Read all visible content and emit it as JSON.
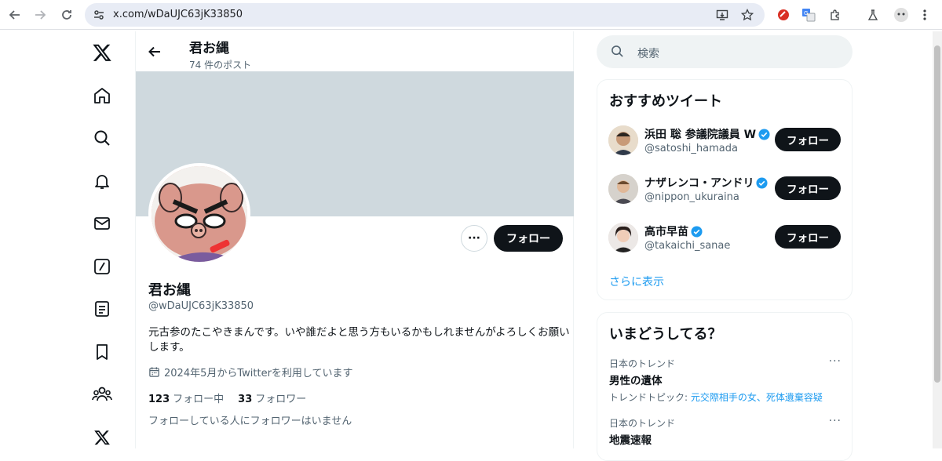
{
  "browser": {
    "url": "x.com/wDaUJC63jK33850"
  },
  "header": {
    "title": "君お縄",
    "post_count": "74 件のポスト"
  },
  "profile": {
    "name": "君お縄",
    "handle": "@wDaUJC63jK33850",
    "bio": "元古参のたこやきまんです。いや誰だよと思う方もいるかもしれませんがよろしくお願いします。",
    "joined": "2024年5月からTwitterを利用しています",
    "following_count": "123",
    "following_label": "フォロー中",
    "followers_count": "33",
    "followers_label": "フォロワー",
    "no_mutual": "フォローしている人にフォロワーはいません",
    "more_label": "···",
    "follow_label": "フォロー"
  },
  "search": {
    "placeholder": "検索"
  },
  "recommendations": {
    "title": "おすすめツイート",
    "items": [
      {
        "name": "浜田 聡 参議院議員 W",
        "handle": "@satoshi_hamada",
        "follow": "フォロー"
      },
      {
        "name": "ナザレンコ・アンドリ",
        "handle": "@nippon_ukuraina",
        "follow": "フォロー"
      },
      {
        "name": "高市早苗",
        "handle": "@takaichi_sanae",
        "follow": "フォロー"
      }
    ],
    "show_more": "さらに表示"
  },
  "trends": {
    "title": "いまどうしてる？",
    "items": [
      {
        "category": "日本のトレンド",
        "name": "男性の遺体",
        "topic_prefix": "トレンドトピック: ",
        "topic_links": "元交際相手の女、死体遺棄容疑"
      },
      {
        "category": "日本のトレンド",
        "name": "地震速報"
      }
    ]
  },
  "colors": {
    "accent": "#1d9bf0",
    "text": "#0f1419",
    "secondary": "#536471",
    "banner": "#cfd9de"
  }
}
